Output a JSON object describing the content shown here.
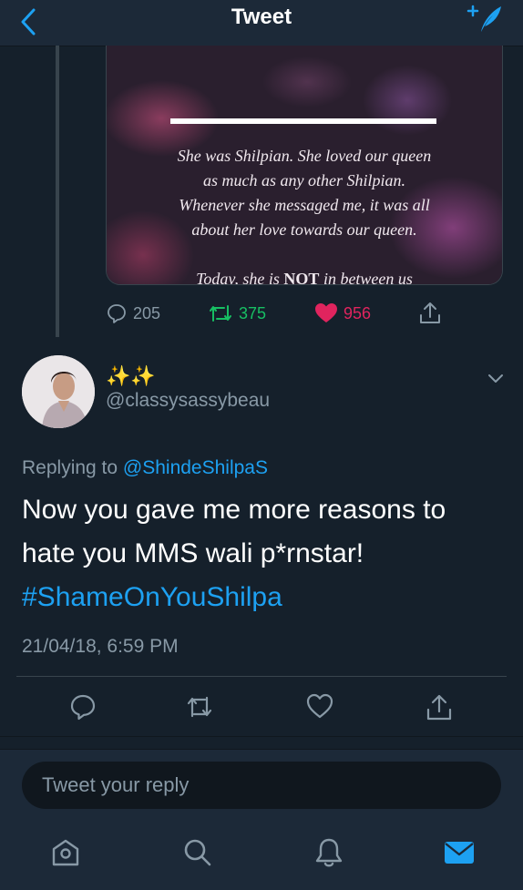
{
  "header": {
    "title": "Tweet",
    "back_icon": "chevron-left-icon",
    "compose_icon": "compose-feather-icon"
  },
  "quoted_media": {
    "lines": [
      "She was Shilpian. She loved our queen",
      "as much as any other Shilpian.",
      "Whenever she messaged me, it was all",
      "about her love towards our queen."
    ],
    "tail_prefix": "Today, she is ",
    "tail_bold": "NOT",
    "tail_suffix": " in between us"
  },
  "parent_actions": {
    "replies": "205",
    "retweets": "375",
    "likes": "956"
  },
  "tweet": {
    "display_name": "✨✨",
    "handle": "@classysassybeau",
    "replying_prefix": "Replying to ",
    "replying_to": "@ShindeShilpaS",
    "text_line1": "Now you gave me more reasons to",
    "text_line2": "hate you MMS wali p*rnstar!",
    "hashtag": "#ShameOnYouShilpa",
    "timestamp": "21/04/18, 6:59 PM"
  },
  "reply_box": {
    "placeholder": "Tweet your reply"
  },
  "colors": {
    "accent": "#1da1f2",
    "retweet": "#17bf63",
    "like": "#e0245e",
    "muted": "#8899a6",
    "bg": "#15202b"
  }
}
